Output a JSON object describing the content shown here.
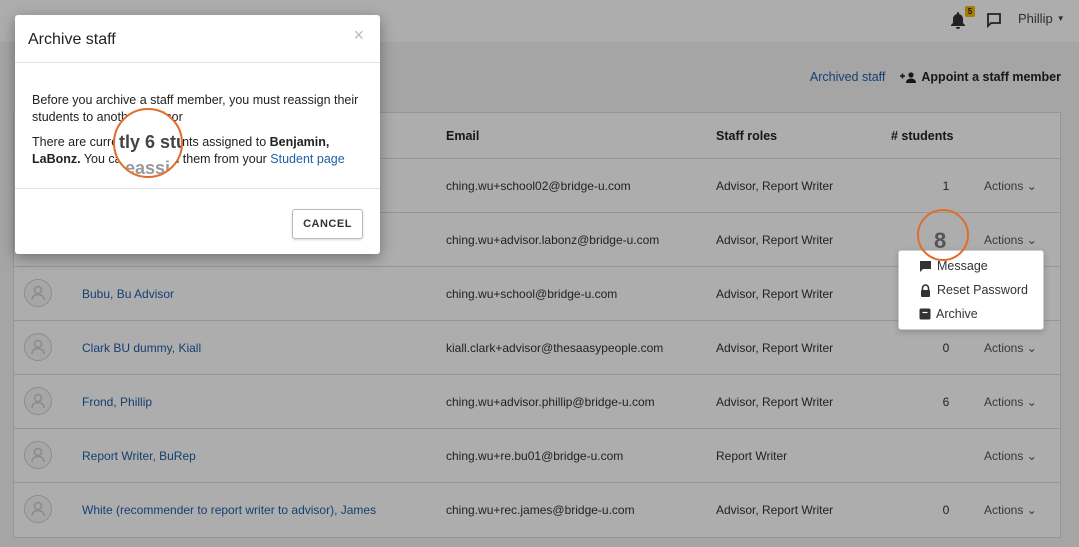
{
  "topbar": {
    "notification_count": "5",
    "user_name": "Phillip"
  },
  "page_actions": {
    "archived_staff": "Archived staff",
    "appoint": "Appoint a staff member"
  },
  "table": {
    "headers": {
      "email": "Email",
      "roles": "Staff roles",
      "students": "# students"
    },
    "rows": [
      {
        "name": "",
        "email": "ching.wu+school02@bridge-u.com",
        "roles": "Advisor, Report Writer",
        "students": "1",
        "actions": "Actions"
      },
      {
        "name": "",
        "email": "ching.wu+advisor.labonz@bridge-u.com",
        "roles": "Advisor, Report Writer",
        "students": "",
        "actions": "Actions"
      },
      {
        "name": "Bubu, Bu Advisor",
        "email": "ching.wu+school@bridge-u.com",
        "roles": "Advisor, Report Writer",
        "students": "",
        "actions": ""
      },
      {
        "name": "Clark BU dummy, Kiall",
        "email": "kiall.clark+advisor@thesaasypeople.com",
        "roles": "Advisor, Report Writer",
        "students": "0",
        "actions": "Actions"
      },
      {
        "name": "Frond, Phillip",
        "email": "ching.wu+advisor.phillip@bridge-u.com",
        "roles": "Advisor, Report Writer",
        "students": "6",
        "actions": "Actions"
      },
      {
        "name": "Report Writer, BuRep",
        "email": "ching.wu+re.bu01@bridge-u.com",
        "roles": "Report Writer",
        "students": "",
        "actions": "Actions"
      },
      {
        "name": "White (recommender to report writer to advisor), James",
        "email": "ching.wu+rec.james@bridge-u.com",
        "roles": "Advisor, Report Writer",
        "students": "0",
        "actions": "Actions"
      }
    ]
  },
  "actions_menu": {
    "message": "Message",
    "reset_password": "Reset Password",
    "archive": "Archive"
  },
  "modal": {
    "title": "Archive staff",
    "close": "×",
    "line1": "Before you archive a staff member, you must reassign their students to another advisor",
    "line2_pre": "There are currently 6 students assigned to ",
    "line2_name": "Benjamin, LaBonz.",
    "line2_mid": " You can reassign them from your ",
    "line2_link": "Student page",
    "cancel": "CANCEL"
  },
  "magnifier": {
    "text1": "tly 6 stu",
    "text2": "eassi",
    "count": "8"
  },
  "colors": {
    "link": "#1f5fa8",
    "highlight_ring": "#e06d2a",
    "badge": "#f2b705"
  }
}
